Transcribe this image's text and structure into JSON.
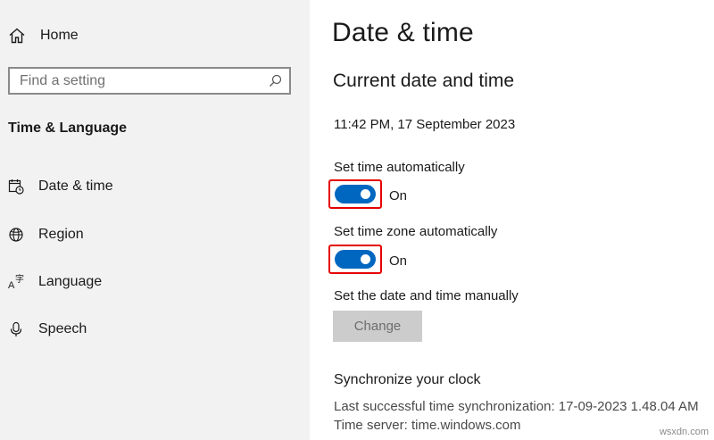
{
  "sidebar": {
    "home_label": "Home",
    "search_placeholder": "Find a setting",
    "group_title": "Time & Language",
    "items": [
      {
        "label": "Date & time",
        "icon": "calendar-clock-icon"
      },
      {
        "label": "Region",
        "icon": "globe-icon"
      },
      {
        "label": "Language",
        "icon": "language-icon"
      },
      {
        "label": "Speech",
        "icon": "microphone-icon"
      }
    ]
  },
  "main": {
    "title": "Date & time",
    "section_title": "Current date and time",
    "current_datetime": "11:42 PM, 17 September 2023",
    "set_time_auto": {
      "label": "Set time automatically",
      "state": "On"
    },
    "set_timezone_auto": {
      "label": "Set time zone automatically",
      "state": "On"
    },
    "manual": {
      "label": "Set the date and time manually",
      "button": "Change"
    },
    "sync": {
      "title": "Synchronize your clock",
      "last_sync": "Last successful time synchronization: 17-09-2023 1.48.04 AM",
      "server": "Time server: time.windows.com"
    }
  },
  "watermark": "wsxdn.com",
  "colors": {
    "accent": "#0067c0",
    "highlight": "#e60000",
    "sidebar_bg": "#f2f2f2"
  }
}
